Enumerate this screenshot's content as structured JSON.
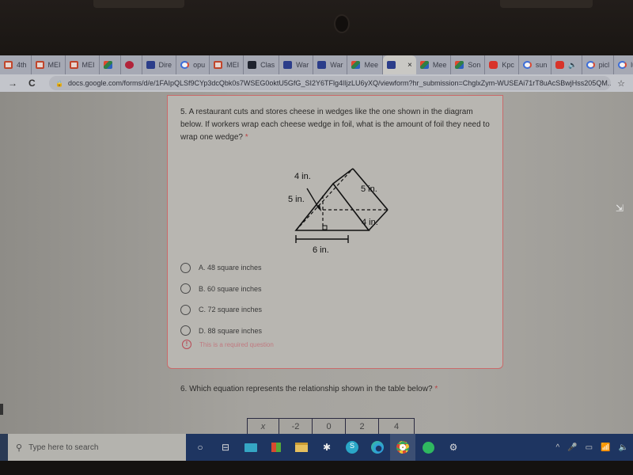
{
  "browser": {
    "tabs": [
      {
        "label": "4th",
        "icon": "mei"
      },
      {
        "label": "MEI",
        "icon": "mei"
      },
      {
        "label": "MEI",
        "icon": "mei"
      },
      {
        "label": "",
        "icon": "meet"
      },
      {
        "label": "",
        "icon": "red"
      },
      {
        "label": "Dire",
        "icon": "doc"
      },
      {
        "label": "opu",
        "icon": "g"
      },
      {
        "label": "MEI",
        "icon": "mei"
      },
      {
        "label": "Clas",
        "icon": "cls"
      },
      {
        "label": "War",
        "icon": "doc"
      },
      {
        "label": "War",
        "icon": "doc"
      },
      {
        "label": "Mee",
        "icon": "meet"
      },
      {
        "label": "",
        "icon": "doc",
        "active": true
      },
      {
        "label": "Mee",
        "icon": "meet"
      },
      {
        "label": "Son",
        "icon": "meet"
      },
      {
        "label": "Kpc",
        "icon": "yt"
      },
      {
        "label": "sun",
        "icon": "g"
      },
      {
        "label": "🔈",
        "icon": "yt"
      },
      {
        "label": "picl",
        "icon": "g"
      },
      {
        "label": "lum",
        "icon": "g"
      }
    ],
    "close_tab_glyph": "×",
    "new_tab_glyph": "+",
    "back_glyph": "→",
    "reload_glyph": "C",
    "lock_glyph": "🔒",
    "star_glyph": "☆",
    "url": "docs.google.com/forms/d/e/1FAIpQLSf9CYp3dcQbk0s7WSEG0oktU5GfG_SI2Y6TFlg4lIjzLU6yXQ/viewform?hr_submission=ChglxZym-WUSEAi71rT8uAcSBwjHss205QM..."
  },
  "question5": {
    "text": "5. A restaurant cuts and stores cheese in wedges like the one shown in the diagram below. If workers wrap each cheese wedge in foil, what is the amount of foil they need to wrap one wedge?",
    "required_marker": "*",
    "diagram_labels": {
      "top_left": "4 in.",
      "left": "5 in.",
      "top_right": "5 in.",
      "right": "4 in.",
      "bottom": "6 in."
    },
    "options": [
      {
        "label": "A. 48 square inches"
      },
      {
        "label": "B. 60 square inches"
      },
      {
        "label": "C. 72 square inches"
      },
      {
        "label": "D. 88 square inches"
      }
    ],
    "error_glyph": "!",
    "error": "This is a required question"
  },
  "question6": {
    "text": "6. Which equation represents the relationship shown in the table below?",
    "required_marker": "*",
    "table_header": [
      "x",
      "-2",
      "0",
      "2",
      "4"
    ]
  },
  "taskbar": {
    "search_placeholder": "Type here to search",
    "search_glyph": "⚲",
    "apps": [
      "cortana",
      "task-view",
      "mail",
      "store",
      "file-explorer",
      "game-app",
      "skype",
      "edge",
      "chrome",
      "spotify",
      "settings"
    ],
    "glyphs": {
      "cortana": "○",
      "task-view": "⊟",
      "settings": "⚙",
      "skype": "S"
    },
    "tray": [
      "^",
      "🎤",
      "▭",
      "📶",
      "🔈"
    ]
  }
}
